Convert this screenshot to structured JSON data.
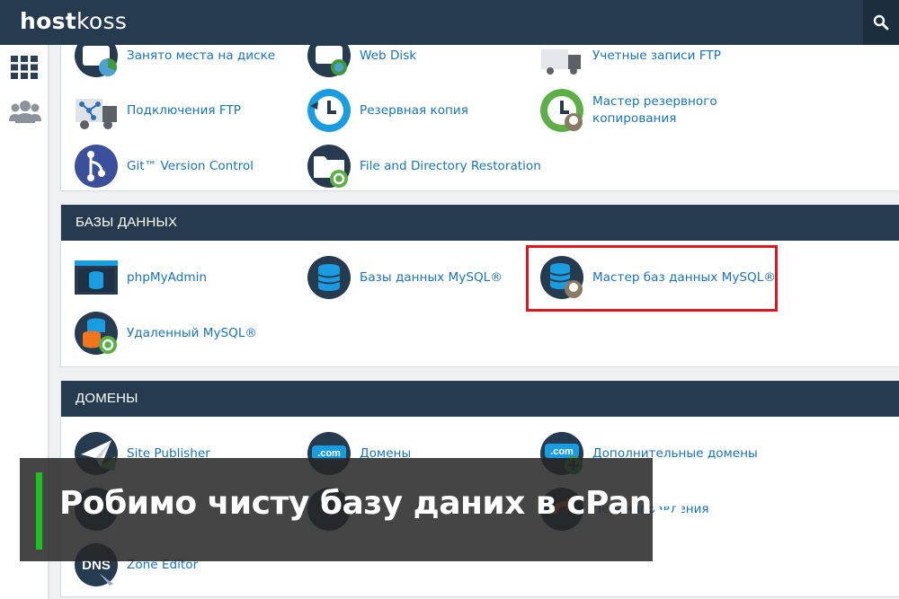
{
  "brand": {
    "logo_bold": "host",
    "logo_rest": "koss"
  },
  "header": {
    "search_icon": "search-icon"
  },
  "sidebar": {
    "icons": [
      "grid-icon",
      "users-icon"
    ]
  },
  "files_section": {
    "items": [
      {
        "label": "Занято места на диске",
        "icon": "disk-usage-icon"
      },
      {
        "label": "Web Disk",
        "icon": "web-disk-icon"
      },
      {
        "label": "Учетные записи FTP",
        "icon": "ftp-accounts-icon"
      },
      {
        "label": "Подключения FTP",
        "icon": "ftp-connections-icon"
      },
      {
        "label": "Резервная копия",
        "icon": "backup-icon"
      },
      {
        "label": "Мастер резервного копирования",
        "icon": "backup-wizard-icon"
      },
      {
        "label": "Git™ Version Control",
        "icon": "git-icon"
      },
      {
        "label": "File and Directory Restoration",
        "icon": "file-restore-icon"
      }
    ]
  },
  "databases_section": {
    "title": "БАЗЫ ДАННЫХ",
    "items": [
      {
        "label": "phpMyAdmin",
        "icon": "phpmyadmin-icon"
      },
      {
        "label": "Базы данных MySQL®",
        "icon": "mysql-databases-icon"
      },
      {
        "label": "Мастер баз данных MySQL®",
        "icon": "mysql-wizard-icon"
      },
      {
        "label": "Удаленный MySQL®",
        "icon": "remote-mysql-icon"
      }
    ]
  },
  "domains_section": {
    "title": "ДОМЕНЫ",
    "items": [
      {
        "label": "Site Publisher",
        "icon": "site-publisher-icon"
      },
      {
        "label": "Домены",
        "icon": "domains-icon"
      },
      {
        "label": "Дополнительные домены",
        "icon": "addon-domains-icon"
      },
      {
        "label": "Перенаправления",
        "icon": "redirects-icon"
      },
      {
        "label": "Zone Editor",
        "icon": "zone-editor-icon"
      }
    ]
  },
  "overlay": {
    "title": "Робимо чисту базу даних в cPanel"
  },
  "colors": {
    "header_bg": "#263b50",
    "link": "#1a73b6",
    "highlight": "#e3141d",
    "accent_green": "#19c41f"
  }
}
